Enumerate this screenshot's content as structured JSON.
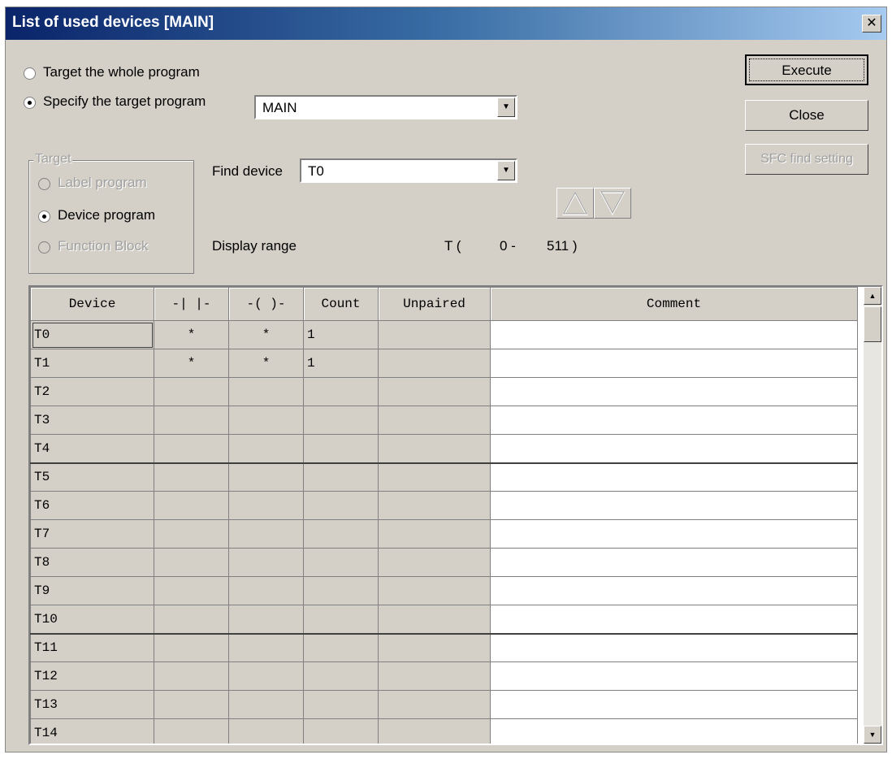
{
  "window": {
    "title": "List of used devices [MAIN]",
    "close": "✕"
  },
  "scope": {
    "whole_label": "Target the whole program",
    "specify_label": "Specify the target program",
    "program_value": "MAIN"
  },
  "target": {
    "group_label": "Target",
    "label_program": "Label program",
    "device_program": "Device program",
    "function_block": "Function Block"
  },
  "find": {
    "label": "Find device",
    "value": "T0"
  },
  "display_range": {
    "label": "Display range",
    "device": "T (",
    "start": "0 -",
    "end": "511 )"
  },
  "buttons": {
    "execute": "Execute",
    "close": "Close",
    "sfc": "SFC find setting"
  },
  "nav": {
    "up": "up-triangle-icon",
    "down": "down-triangle-icon"
  },
  "table": {
    "headers": [
      "Device",
      "-| |-",
      "-( )-",
      "Count",
      "Unpaired",
      "Comment"
    ],
    "rows": [
      [
        "T0",
        "*",
        "*",
        "1",
        "",
        ""
      ],
      [
        "T1",
        "*",
        "*",
        "1",
        "",
        ""
      ],
      [
        "T2",
        "",
        "",
        "",
        "",
        ""
      ],
      [
        "T3",
        "",
        "",
        "",
        "",
        ""
      ],
      [
        "T4",
        "",
        "",
        "",
        "",
        ""
      ],
      [
        "T5",
        "",
        "",
        "",
        "",
        ""
      ],
      [
        "T6",
        "",
        "",
        "",
        "",
        ""
      ],
      [
        "T7",
        "",
        "",
        "",
        "",
        ""
      ],
      [
        "T8",
        "",
        "",
        "",
        "",
        ""
      ],
      [
        "T9",
        "",
        "",
        "",
        "",
        ""
      ],
      [
        "T10",
        "",
        "",
        "",
        "",
        ""
      ],
      [
        "T11",
        "",
        "",
        "",
        "",
        ""
      ],
      [
        "T12",
        "",
        "",
        "",
        "",
        ""
      ],
      [
        "T13",
        "",
        "",
        "",
        "",
        ""
      ],
      [
        "T14",
        "",
        "",
        "",
        "",
        ""
      ]
    ]
  }
}
